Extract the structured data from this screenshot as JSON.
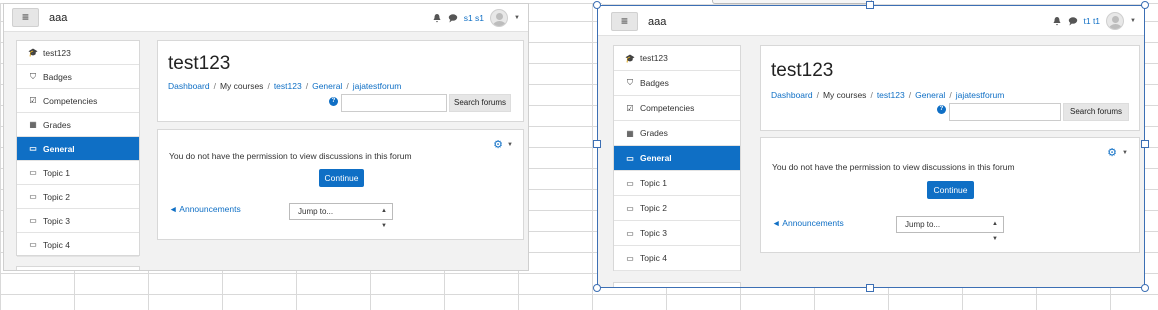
{
  "left": {
    "site_name": "aaa",
    "user_name": "s1 s1",
    "drawer": [
      "test123",
      "Badges",
      "Competencies",
      "Grades",
      "General",
      "Topic 1",
      "Topic 2",
      "Topic 3",
      "Topic 4"
    ],
    "active_index": 4,
    "title": "test123",
    "breadcrumb": [
      "Dashboard",
      "My courses",
      "test123",
      "General",
      "jajatestforum"
    ],
    "search_button": "Search forums",
    "message": "You do not have the permission to view discussions in this forum",
    "continue": "Continue",
    "prev_link": "◄ Announcements",
    "jump": "Jump to..."
  },
  "right": {
    "site_name": "aaa",
    "user_name": "t1 t1",
    "drawer": [
      "test123",
      "Badges",
      "Competencies",
      "Grades",
      "General",
      "Topic 1",
      "Topic 2",
      "Topic 3",
      "Topic 4"
    ],
    "active_index": 4,
    "title": "test123",
    "breadcrumb": [
      "Dashboard",
      "My courses",
      "test123",
      "General",
      "jajatestforum"
    ],
    "search_button": "Search forums",
    "message": "You do not have the permission to view discussions in this forum",
    "continue": "Continue",
    "prev_link": "◄ Announcements",
    "jump": "Jump to..."
  },
  "icons": {
    "menu": "hamburger-icon",
    "bell": "bell-icon",
    "chat": "chat-icon",
    "gear": "gear-icon",
    "help": "help-icon"
  },
  "colors": {
    "accent": "#0f6fc5",
    "selection": "#3c6fb4"
  }
}
